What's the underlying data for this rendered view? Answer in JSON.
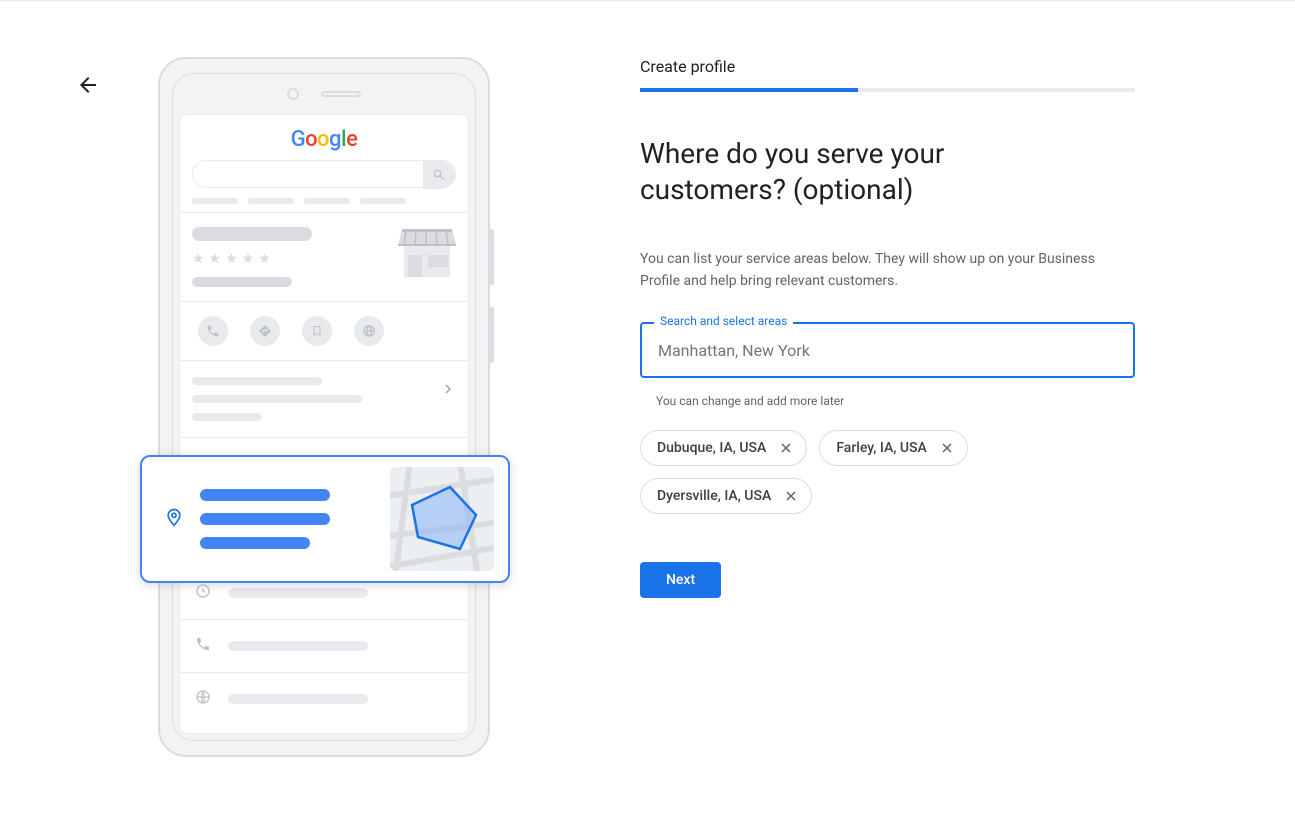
{
  "step_title": "Create profile",
  "progress_percent": 44,
  "headline": "Where do you serve your customers? (optional)",
  "subtext": "You can list your service areas below. They will show up on your Business Profile and help bring relevant customers.",
  "search_field": {
    "label": "Search and select areas",
    "placeholder": "Manhattan, New York",
    "helper": "You can change and add more later"
  },
  "selected_areas": [
    "Dubuque, IA, USA",
    "Farley, IA, USA",
    "Dyersville, IA, USA"
  ],
  "next_label": "Next",
  "phone_mock": {
    "logo": "Google"
  }
}
